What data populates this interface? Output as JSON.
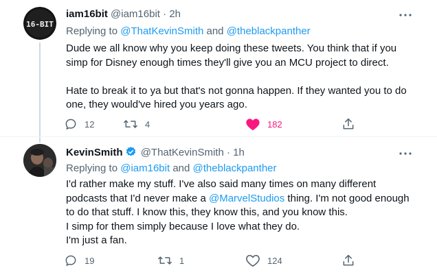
{
  "tweets": [
    {
      "display_name": "iam16bit",
      "handle": "@iam16bit",
      "separator": "·",
      "time": "2h",
      "avatar_text": "16-BIT",
      "replying_prefix": "Replying to ",
      "replying_user1": "@ThatKevinSmith",
      "replying_and": " and ",
      "replying_user2": "@theblackpanther",
      "body_line1": "Dude we all know why you keep doing these tweets. You think that if you",
      "body_line2": "simp for Disney enough times they'll give you an MCU project to direct.",
      "body_line3": "Hate to break it to ya but that's not gonna happen. If they wanted you to do",
      "body_line4": "one, they would've hired you years ago.",
      "replies": "12",
      "retweets": "4",
      "likes": "182",
      "liked": true
    },
    {
      "display_name": "KevinSmith",
      "handle": "@ThatKevinSmith",
      "separator": "·",
      "time": "1h",
      "verified": true,
      "replying_prefix": "Replying to ",
      "replying_user1": "@iam16bit",
      "replying_and": " and ",
      "replying_user2": "@theblackpanther",
      "body_line1": "I'd rather make my stuff. I've also said many times on many different",
      "body_line2_pre": "podcasts that I'd never make a ",
      "body_line2_mention": "@MarvelStudios",
      "body_line2_post": " thing. I'm not good enough",
      "body_line3": "to do that stuff. I know this, they know this, and you know this.",
      "body_line4": "I simp for them simply because I love what they do.",
      "body_line5": "I'm just a fan.",
      "replies": "19",
      "retweets": "1",
      "likes": "124",
      "liked": false
    }
  ],
  "colors": {
    "accent": "#1d9bf0",
    "like_active": "#f91880",
    "secondary_text": "#536471",
    "thread_line": "#cfd9de"
  },
  "icons": [
    "more-icon",
    "reply-icon",
    "retweet-icon",
    "like-icon",
    "share-icon",
    "verified-icon"
  ]
}
